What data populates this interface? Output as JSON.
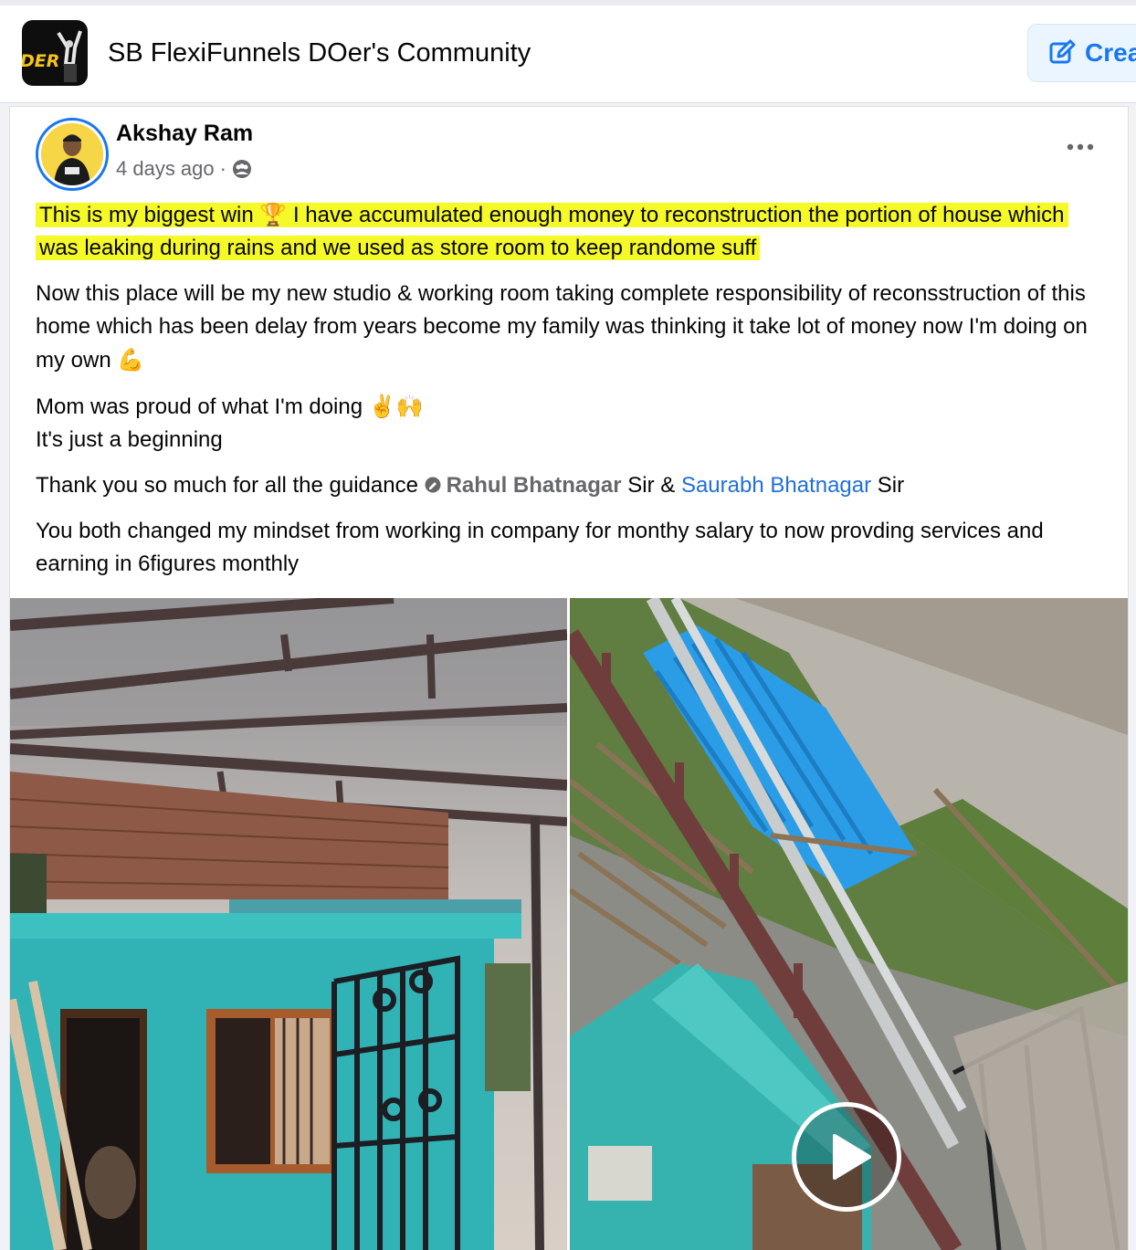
{
  "header": {
    "group_name": "SB FlexiFunnels DOer's Community",
    "logo_text": "DER",
    "create_label": "Crea",
    "create_icon": "edit-icon"
  },
  "post": {
    "author": "Akshay Ram",
    "time": "4 days ago",
    "separator": "·",
    "audience_icon": "group-privacy-icon",
    "more_icon": "more-horizontal-icon",
    "highlight_part1": "This is  my biggest win ",
    "highlight_emoji": "🏆",
    "highlight_part2": "  I have  accumulated enough money to reconstruction the portion of house which was leaking during rains and we used as store room to keep randome suff  ",
    "paragraph2": "Now this place will be my  new studio & working room taking complete responsibility of reconsstruction of this home which has been delay from years become my family was thinking it take lot of money now I'm doing on my own ",
    "paragraph2_emoji": "💪",
    "paragraph3_line1": "Mom was proud of what I'm doing ",
    "paragraph3_emoji": "✌️🙌",
    "paragraph3_line2": "It's just a beginning",
    "thanks_prefix": "Thank you so much for all the guidance ",
    "mention1": "Rahul Bhatnagar",
    "mention1_suffix": " Sir & ",
    "mention2": "Saurabh Bhatnagar",
    "mention2_suffix": " Sir",
    "paragraph5": "You both changed my mindset from working in company for monthy salary to now provding services and earning in 6figures monthly"
  },
  "media": {
    "left_description_icon": "photo-house-construction",
    "right_description_icon": "video-roof-sheets",
    "play_icon": "play-icon"
  },
  "colors": {
    "highlight": "#f6f928",
    "accent": "#1877f2",
    "mention_link": "#216fdb"
  }
}
